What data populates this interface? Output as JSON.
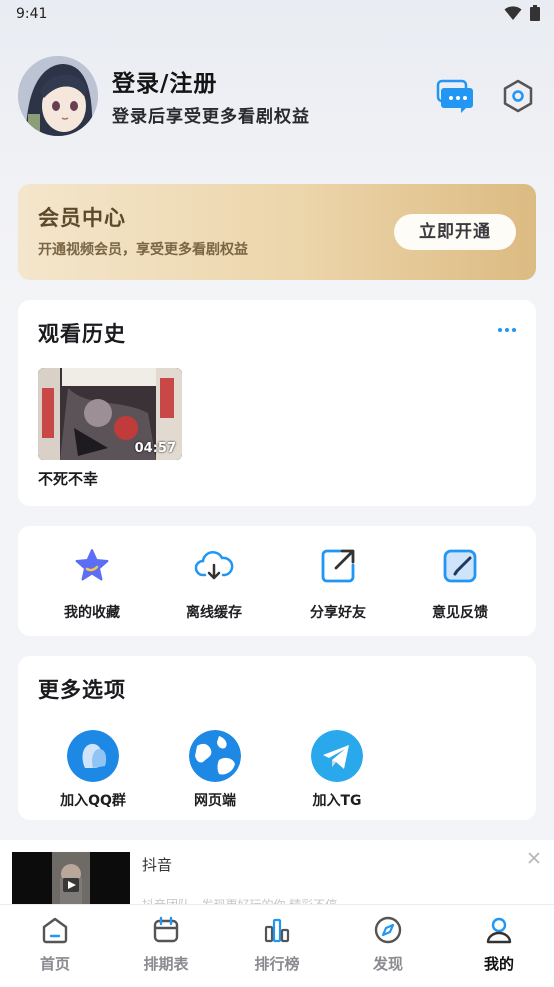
{
  "status_bar": {
    "time": "9:41"
  },
  "profile": {
    "title": "登录/注册",
    "subtitle": "登录后享受更多看剧权益",
    "avatar_icon": "avatar",
    "message_icon": "chat-bubble-icon",
    "settings_icon": "hexagon-settings-icon"
  },
  "vip": {
    "title": "会员中心",
    "subtitle": "开通视频会员，享受更多看剧权益",
    "button": "立即开通"
  },
  "history": {
    "title": "观看历史",
    "items": [
      {
        "name": "不死不幸",
        "duration": "04:57"
      }
    ]
  },
  "actions": [
    {
      "label": "我的收藏",
      "icon": "star-icon"
    },
    {
      "label": "离线缓存",
      "icon": "cloud-download-icon"
    },
    {
      "label": "分享好友",
      "icon": "share-icon"
    },
    {
      "label": "意见反馈",
      "icon": "edit-icon"
    }
  ],
  "more": {
    "title": "更多选项",
    "options": [
      {
        "label": "加入QQ群",
        "icon": "qq-icon",
        "color": "#1e88e5"
      },
      {
        "label": "网页端",
        "icon": "globe-icon",
        "color": "#1e88e5"
      },
      {
        "label": "加入TG",
        "icon": "telegram-icon",
        "color": "#29a9eb"
      }
    ]
  },
  "ad": {
    "title": "抖音",
    "desc": "抖音团队 · 发现更好玩的你 精彩不停"
  },
  "tabs": [
    {
      "label": "首页",
      "icon": "home-icon"
    },
    {
      "label": "排期表",
      "icon": "calendar-icon"
    },
    {
      "label": "排行榜",
      "icon": "bar-chart-icon"
    },
    {
      "label": "发现",
      "icon": "compass-icon"
    },
    {
      "label": "我的",
      "icon": "user-icon",
      "active": true
    }
  ],
  "colors": {
    "accent": "#1e88e5",
    "vip_gold": "#dcbb82"
  }
}
